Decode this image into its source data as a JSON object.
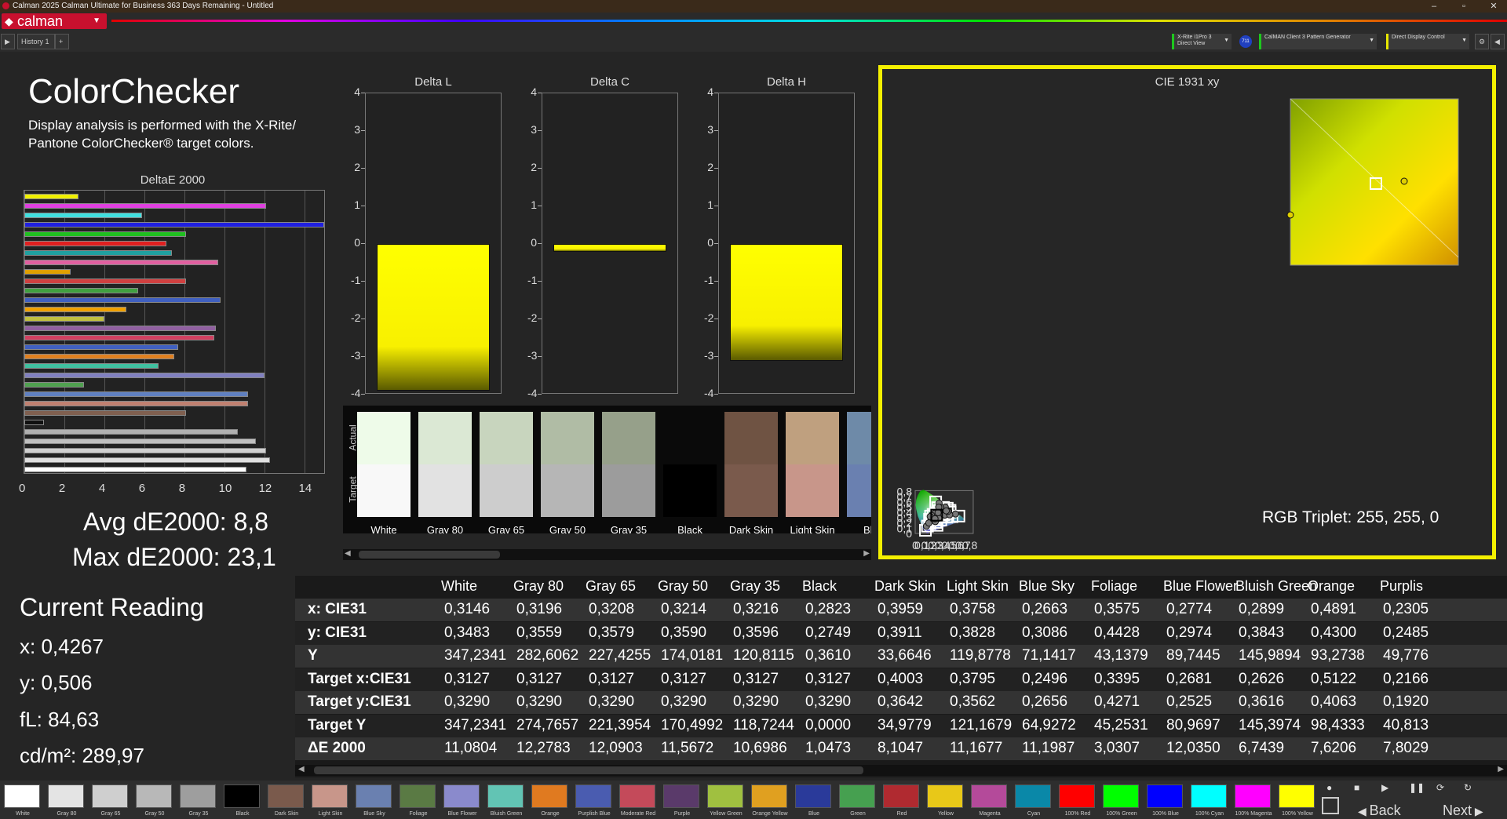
{
  "titlebar": {
    "text": "Calman 2025 Calman Ultimate for Business 363 Days Remaining - Untitled"
  },
  "brand": {
    "logo": "calman"
  },
  "toolbar": {
    "history_tab": "History 1",
    "meter_line1": "X-Rite i1Pro 3",
    "meter_line2": "Direct View",
    "meter_badge": "711",
    "generator": "CalMAN Client 3 Pattern Generator",
    "display": "Direct Display Control"
  },
  "page": {
    "title": "ColorChecker",
    "description": "Display analysis is performed with the X-Rite/ Pantone ColorChecker® target colors."
  },
  "delta_e_chart": {
    "title": "DeltaE 2000",
    "xticks": [
      "0",
      "2",
      "4",
      "6",
      "8",
      "10",
      "12",
      "14"
    ],
    "xlim": [
      0,
      15
    ],
    "bars": [
      {
        "color": "#f0f000",
        "value": 2.7
      },
      {
        "color": "#e040e0",
        "value": 12.1
      },
      {
        "color": "#40e0e0",
        "value": 5.9
      },
      {
        "color": "#2020e0",
        "value": 15.0
      },
      {
        "color": "#20c020",
        "value": 8.1
      },
      {
        "color": "#e02020",
        "value": 7.1
      },
      {
        "color": "#20a0a0",
        "value": 7.4
      },
      {
        "color": "#e060a0",
        "value": 9.7
      },
      {
        "color": "#e0a000",
        "value": 2.3
      },
      {
        "color": "#d04040",
        "value": 8.1
      },
      {
        "color": "#40a040",
        "value": 5.7
      },
      {
        "color": "#4060c0",
        "value": 9.8
      },
      {
        "color": "#f0a000",
        "value": 5.1
      },
      {
        "color": "#c0c040",
        "value": 4.0
      },
      {
        "color": "#9060a0",
        "value": 9.6
      },
      {
        "color": "#d04060",
        "value": 9.5
      },
      {
        "color": "#4060c0",
        "value": 7.7
      },
      {
        "color": "#e08020",
        "value": 7.5
      },
      {
        "color": "#40c0a0",
        "value": 6.7
      },
      {
        "color": "#8080c0",
        "value": 12.0
      },
      {
        "color": "#50a050",
        "value": 3.0
      },
      {
        "color": "#6080c0",
        "value": 11.2
      },
      {
        "color": "#c08070",
        "value": 11.2
      },
      {
        "color": "#806050",
        "value": 8.1
      },
      {
        "color": "#101010",
        "value": 1.0
      },
      {
        "color": "#b0b0b0",
        "value": 10.7
      },
      {
        "color": "#c0c0c0",
        "value": 11.6
      },
      {
        "color": "#d0d0d0",
        "value": 12.1
      },
      {
        "color": "#e0e0e0",
        "value": 12.3
      },
      {
        "color": "#ffffff",
        "value": 11.1
      }
    ]
  },
  "stats": {
    "avg": "Avg dE2000: 8,8",
    "max": "Max dE2000: 23,1"
  },
  "current_reading": {
    "title": "Current Reading",
    "x": "x: 0,4267",
    "y": "y: 0,506",
    "fl": "fL: 84,63",
    "cdm2": "cd/m²: 289,97"
  },
  "delta_charts": [
    {
      "title": "Delta L",
      "value": -3.9,
      "yticks": [
        "4",
        "3",
        "2",
        "1",
        "0",
        "-1",
        "-2",
        "-3",
        "-4"
      ]
    },
    {
      "title": "Delta C",
      "value": -0.2,
      "yticks": [
        "4",
        "3",
        "2",
        "1",
        "0",
        "-1",
        "-2",
        "-3",
        "-4"
      ]
    },
    {
      "title": "Delta H",
      "value": -3.1,
      "yticks": [
        "4",
        "3",
        "2",
        "1",
        "0",
        "-1",
        "-2",
        "-3",
        "-4"
      ]
    }
  ],
  "swatch_panel": {
    "actual_label": "Actual",
    "target_label": "Target",
    "swatches": [
      {
        "label": "White",
        "actual": "#eefbe9",
        "target": "#f8f8f8"
      },
      {
        "label": "Gray 80",
        "actual": "#dbe8d4",
        "target": "#e2e2e2"
      },
      {
        "label": "Gray 65",
        "actual": "#c8d5be",
        "target": "#cdcdcd"
      },
      {
        "label": "Gray 50",
        "actual": "#b0bca5",
        "target": "#b6b6b6"
      },
      {
        "label": "Gray 35",
        "actual": "#96a08a",
        "target": "#9c9c9c"
      },
      {
        "label": "Black",
        "actual": "#0a0a0a",
        "target": "#000000"
      },
      {
        "label": "Dark Skin",
        "actual": "#6f5343",
        "target": "#7a5a4c"
      },
      {
        "label": "Light Skin",
        "actual": "#bfa07f",
        "target": "#c8968a"
      },
      {
        "label": "Blue",
        "actual": "#6e8aa8",
        "target": "#6a80b0"
      }
    ]
  },
  "cie": {
    "title": "CIE 1931 xy",
    "xticks": [
      "0",
      "0,1",
      "0,2",
      "0,3",
      "0,4",
      "0,5",
      "0,6",
      "0,7",
      "0,8"
    ],
    "yticks": [
      "0,8",
      "0,7",
      "0,6",
      "0,5",
      "0,4",
      "0,3",
      "0,2",
      "0,1",
      "0"
    ],
    "triplet": "RGB Triplet: 255, 255, 0"
  },
  "table": {
    "columns": [
      "White",
      "Gray 80",
      "Gray 65",
      "Gray 50",
      "Gray 35",
      "Black",
      "Dark Skin",
      "Light Skin",
      "Blue Sky",
      "Foliage",
      "Blue Flower",
      "Bluish Green",
      "Orange",
      "Purplis"
    ],
    "rows": [
      {
        "label": "x: CIE31",
        "values": [
          "0,3146",
          "0,3196",
          "0,3208",
          "0,3214",
          "0,3216",
          "0,2823",
          "0,3959",
          "0,3758",
          "0,2663",
          "0,3575",
          "0,2774",
          "0,2899",
          "0,4891",
          "0,2305"
        ]
      },
      {
        "label": "y: CIE31",
        "values": [
          "0,3483",
          "0,3559",
          "0,3579",
          "0,3590",
          "0,3596",
          "0,2749",
          "0,3911",
          "0,3828",
          "0,3086",
          "0,4428",
          "0,2974",
          "0,3843",
          "0,4300",
          "0,2485"
        ]
      },
      {
        "label": "Y",
        "values": [
          "347,2341",
          "282,6062",
          "227,4255",
          "174,0181",
          "120,8115",
          "0,3610",
          "33,6646",
          "119,8778",
          "71,1417",
          "43,1379",
          "89,7445",
          "145,9894",
          "93,2738",
          "49,776"
        ]
      },
      {
        "label": "Target x:CIE31",
        "values": [
          "0,3127",
          "0,3127",
          "0,3127",
          "0,3127",
          "0,3127",
          "0,3127",
          "0,4003",
          "0,3795",
          "0,2496",
          "0,3395",
          "0,2681",
          "0,2626",
          "0,5122",
          "0,2166"
        ]
      },
      {
        "label": "Target y:CIE31",
        "values": [
          "0,3290",
          "0,3290",
          "0,3290",
          "0,3290",
          "0,3290",
          "0,3290",
          "0,3642",
          "0,3562",
          "0,2656",
          "0,4271",
          "0,2525",
          "0,3616",
          "0,4063",
          "0,1920"
        ]
      },
      {
        "label": "Target Y",
        "values": [
          "347,2341",
          "274,7657",
          "221,3954",
          "170,4992",
          "118,7244",
          "0,0000",
          "34,9779",
          "121,1679",
          "64,9272",
          "45,2531",
          "80,9697",
          "145,3974",
          "98,4333",
          "40,813"
        ]
      },
      {
        "label": "ΔE 2000",
        "values": [
          "11,0804",
          "12,2783",
          "12,0903",
          "11,5672",
          "10,6986",
          "1,0473",
          "8,1047",
          "11,1677",
          "11,1987",
          "3,0307",
          "12,0350",
          "6,7439",
          "7,6206",
          "7,8029"
        ]
      }
    ]
  },
  "palette": [
    {
      "label": "White",
      "color": "#ffffff"
    },
    {
      "label": "Gray 80",
      "color": "#e4e4e4"
    },
    {
      "label": "Gray 65",
      "color": "#cfcfcf"
    },
    {
      "label": "Gray 50",
      "color": "#b8b8b8"
    },
    {
      "label": "Gray 35",
      "color": "#9e9e9e"
    },
    {
      "label": "Black",
      "color": "#000000"
    },
    {
      "label": "Dark Skin",
      "color": "#7a5a4c"
    },
    {
      "label": "Light Skin",
      "color": "#c8968a"
    },
    {
      "label": "Blue Sky",
      "color": "#6a80b0"
    },
    {
      "label": "Foliage",
      "color": "#5a7a44"
    },
    {
      "label": "Blue Flower",
      "color": "#8a8acc"
    },
    {
      "label": "Bluish Green",
      "color": "#62c4b4"
    },
    {
      "label": "Orange",
      "color": "#e07a20"
    },
    {
      "label": "Purplish Blue",
      "color": "#4a5cb0"
    },
    {
      "label": "Moderate Red",
      "color": "#c44a5a"
    },
    {
      "label": "Purple",
      "color": "#5a3a6a"
    },
    {
      "label": "Yellow Green",
      "color": "#a0c040"
    },
    {
      "label": "Orange Yellow",
      "color": "#e0a020"
    },
    {
      "label": "Blue",
      "color": "#2a3a9a"
    },
    {
      "label": "Green",
      "color": "#46a050"
    },
    {
      "label": "Red",
      "color": "#b02a30"
    },
    {
      "label": "Yellow",
      "color": "#e8c818"
    },
    {
      "label": "Magenta",
      "color": "#b44a9a"
    },
    {
      "label": "Cyan",
      "color": "#0a88a8"
    },
    {
      "label": "100% Red",
      "color": "#ff0000"
    },
    {
      "label": "100% Green",
      "color": "#00ff00"
    },
    {
      "label": "100% Blue",
      "color": "#0000ff"
    },
    {
      "label": "100% Cyan",
      "color": "#00ffff"
    },
    {
      "label": "100% Magenta",
      "color": "#ff00ff"
    },
    {
      "label": "100% Yellow",
      "color": "#ffff00"
    }
  ],
  "nav": {
    "back": "Back",
    "next": "Next"
  }
}
